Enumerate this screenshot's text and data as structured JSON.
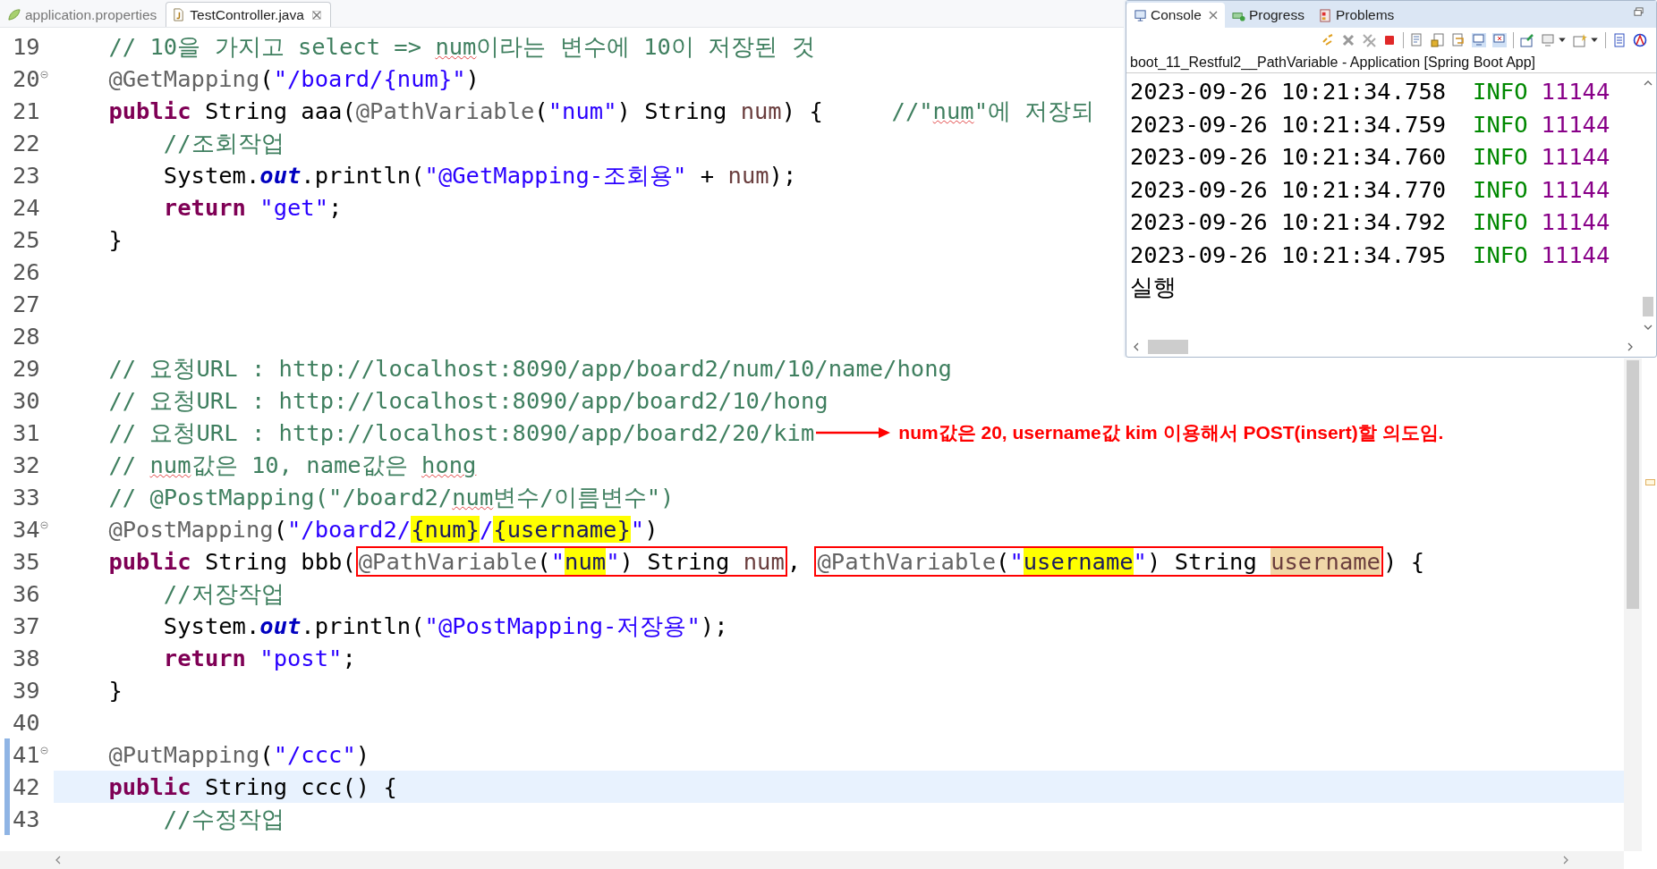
{
  "editor": {
    "tabs": [
      {
        "label": "application.properties",
        "selected": false,
        "closable": false
      },
      {
        "label": "TestController.java",
        "selected": true,
        "closable": true
      }
    ],
    "lines": [
      {
        "number": "19",
        "tokens": [
          {
            "kind": "comment",
            "text": "    // 10을 가지고 select => "
          },
          {
            "kind": "typo",
            "text": "num"
          },
          {
            "kind": "comment",
            "text": "이라는 변수에 10이 저장된 것"
          }
        ]
      },
      {
        "number": "20",
        "foldable": true,
        "tokens": [
          {
            "kind": "annotation",
            "text": "    @GetMapping"
          },
          {
            "kind": "plain",
            "text": "("
          },
          {
            "kind": "string",
            "text": "\"/board/{num}\""
          },
          {
            "kind": "plain",
            "text": ")"
          }
        ]
      },
      {
        "number": "21",
        "tokens": [
          {
            "kind": "keyword",
            "text": "    public"
          },
          {
            "kind": "plain",
            "text": " String aaa("
          },
          {
            "kind": "annotation",
            "text": "@PathVariable"
          },
          {
            "kind": "plain",
            "text": "("
          },
          {
            "kind": "string",
            "text": "\"num\""
          },
          {
            "kind": "plain",
            "text": ") String "
          },
          {
            "kind": "variable",
            "text": "num"
          },
          {
            "kind": "plain",
            "text": ") {     "
          },
          {
            "kind": "comment",
            "text": "//\""
          },
          {
            "kind": "typo",
            "text": "num"
          },
          {
            "kind": "comment",
            "text": "\"에 저장되"
          }
        ]
      },
      {
        "number": "22",
        "tokens": [
          {
            "kind": "comment",
            "text": "        //조회작업"
          }
        ]
      },
      {
        "number": "23",
        "tokens": [
          {
            "kind": "plain",
            "text": "        System."
          },
          {
            "kind": "field",
            "text": "out"
          },
          {
            "kind": "plain",
            "text": ".println("
          },
          {
            "kind": "string",
            "text": "\"@GetMapping-조회용\""
          },
          {
            "kind": "plain",
            "text": " + "
          },
          {
            "kind": "variable",
            "text": "num"
          },
          {
            "kind": "plain",
            "text": ");"
          }
        ]
      },
      {
        "number": "24",
        "tokens": [
          {
            "kind": "keyword",
            "text": "        return "
          },
          {
            "kind": "string",
            "text": "\"get\""
          },
          {
            "kind": "plain",
            "text": ";"
          }
        ]
      },
      {
        "number": "25",
        "tokens": [
          {
            "kind": "plain",
            "text": "    }"
          }
        ]
      },
      {
        "number": "26"
      },
      {
        "number": "27"
      },
      {
        "number": "28"
      },
      {
        "number": "29",
        "tokens": [
          {
            "kind": "comment",
            "text": "    // 요청URL : http://localhost:8090/app/board2/num/10/name/hong"
          }
        ]
      },
      {
        "number": "30",
        "tokens": [
          {
            "kind": "comment",
            "text": "    // 요청URL : http://localhost:8090/app/board2/10/hong"
          }
        ]
      },
      {
        "number": "31",
        "tokens": [
          {
            "kind": "comment",
            "text": "    // 요청URL : http://localhost:8090/app/board2/20/kim"
          }
        ],
        "note": "num값은 20, username값 kim 이용해서 POST(insert)할 의도임."
      },
      {
        "number": "32",
        "tokens": [
          {
            "kind": "comment",
            "text": "    // "
          },
          {
            "kind": "typo",
            "text": "num"
          },
          {
            "kind": "comment",
            "text": "값은 10, name값은 "
          },
          {
            "kind": "typo",
            "text": "hong"
          }
        ]
      },
      {
        "number": "33",
        "tokens": [
          {
            "kind": "comment",
            "text": "    // @PostMapping(\"/board2/"
          },
          {
            "kind": "typo",
            "text": "num"
          },
          {
            "kind": "comment",
            "text": "변수/이름변수\")"
          }
        ]
      },
      {
        "number": "34",
        "foldable": true,
        "tokens": [
          {
            "kind": "annotation",
            "text": "    @PostMapping"
          },
          {
            "kind": "plain",
            "text": "("
          },
          {
            "kind": "string",
            "text": "\"/board2/"
          },
          {
            "kind": "mark",
            "text": "{num}"
          },
          {
            "kind": "string",
            "text": "/"
          },
          {
            "kind": "mark",
            "text": "{username}"
          },
          {
            "kind": "string",
            "text": "\""
          },
          {
            "kind": "plain",
            "text": ")"
          }
        ]
      },
      {
        "number": "35",
        "tokens": [
          {
            "kind": "keyword",
            "text": "    public"
          },
          {
            "kind": "plain",
            "text": " String bbb("
          },
          {
            "kind": "box",
            "tokens": [
              {
                "kind": "annotation",
                "text": "@PathVariable"
              },
              {
                "kind": "plain",
                "text": "("
              },
              {
                "kind": "string",
                "text": "\""
              },
              {
                "kind": "mark",
                "text": "num"
              },
              {
                "kind": "string",
                "text": "\""
              },
              {
                "kind": "plain",
                "text": ") String "
              },
              {
                "kind": "variable",
                "text": "num"
              }
            ]
          },
          {
            "kind": "plain",
            "text": ", "
          },
          {
            "kind": "box",
            "tokens": [
              {
                "kind": "annotation",
                "text": "@PathVariable"
              },
              {
                "kind": "plain",
                "text": "("
              },
              {
                "kind": "string",
                "text": "\""
              },
              {
                "kind": "mark",
                "text": "username"
              },
              {
                "kind": "string",
                "text": "\""
              },
              {
                "kind": "plain",
                "text": ") String "
              },
              {
                "kind": "occurrence",
                "text": "username"
              }
            ]
          },
          {
            "kind": "plain",
            "text": ") {"
          }
        ]
      },
      {
        "number": "36",
        "tokens": [
          {
            "kind": "comment",
            "text": "        //저장작업"
          }
        ]
      },
      {
        "number": "37",
        "tokens": [
          {
            "kind": "plain",
            "text": "        System."
          },
          {
            "kind": "field",
            "text": "out"
          },
          {
            "kind": "plain",
            "text": ".println("
          },
          {
            "kind": "string",
            "text": "\"@PostMapping-저장용\""
          },
          {
            "kind": "plain",
            "text": ");"
          }
        ]
      },
      {
        "number": "38",
        "tokens": [
          {
            "kind": "keyword",
            "text": "        return "
          },
          {
            "kind": "string",
            "text": "\"post\""
          },
          {
            "kind": "plain",
            "text": ";"
          }
        ]
      },
      {
        "number": "39",
        "tokens": [
          {
            "kind": "plain",
            "text": "    }"
          }
        ]
      },
      {
        "number": "40"
      },
      {
        "number": "41",
        "foldable": true,
        "changed": true,
        "tokens": [
          {
            "kind": "annotation",
            "text": "    @PutMapping"
          },
          {
            "kind": "plain",
            "text": "("
          },
          {
            "kind": "string",
            "text": "\"/ccc\""
          },
          {
            "kind": "plain",
            "text": ")"
          }
        ]
      },
      {
        "number": "42",
        "current": true,
        "changed": true,
        "tokens": [
          {
            "kind": "keyword",
            "text": "    public"
          },
          {
            "kind": "plain",
            "text": " String ccc() {"
          }
        ]
      },
      {
        "number": "43",
        "changed": true,
        "tokens": [
          {
            "kind": "comment",
            "text": "        //수정작업"
          }
        ]
      }
    ]
  },
  "console": {
    "tabs": [
      {
        "label": "Console",
        "selected": true,
        "closable": true
      },
      {
        "label": "Progress",
        "selected": false,
        "closable": false
      },
      {
        "label": "Problems",
        "selected": false,
        "closable": false
      }
    ],
    "title": "boot_11_Restful2__PathVariable - Application [Spring Boot App]",
    "lines": [
      {
        "kind": "log",
        "time": "2023-09-26 10:21:34.758",
        "level": "INFO",
        "pid": "11144"
      },
      {
        "kind": "log",
        "time": "2023-09-26 10:21:34.759",
        "level": "INFO",
        "pid": "11144"
      },
      {
        "kind": "log",
        "time": "2023-09-26 10:21:34.760",
        "level": "INFO",
        "pid": "11144"
      },
      {
        "kind": "log",
        "time": "2023-09-26 10:21:34.770",
        "level": "INFO",
        "pid": "11144"
      },
      {
        "kind": "log",
        "time": "2023-09-26 10:21:34.792",
        "level": "INFO",
        "pid": "11144"
      },
      {
        "kind": "log",
        "time": "2023-09-26 10:21:34.795",
        "level": "INFO",
        "pid": "11144"
      },
      {
        "kind": "text",
        "text": "실행"
      }
    ]
  }
}
